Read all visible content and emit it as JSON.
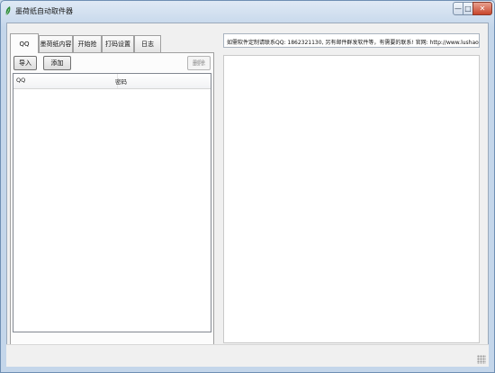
{
  "window": {
    "title": "墨荷纸自动取件器",
    "controls": {
      "minimize": "—",
      "maximize": "□",
      "close": "✕"
    }
  },
  "tabs": [
    {
      "label": "QQ",
      "active": true
    },
    {
      "label": "墨荷纸内容",
      "active": false
    },
    {
      "label": "开始抢",
      "active": false
    },
    {
      "label": "打码设置",
      "active": false
    },
    {
      "label": "日志",
      "active": false
    }
  ],
  "toolbar": {
    "import_label": "导入",
    "add_label": "添加",
    "delete_label": "删除"
  },
  "account_list": {
    "columns": [
      "QQ",
      "密码"
    ],
    "rows": []
  },
  "info_bar": {
    "value": "如需软件定制请联系QQ: 1862321130, 另有邮件群发软件等，有需要的联系! 官网: http://www.lushaolin.com"
  },
  "colors": {
    "titlebar": "#c4d6ea",
    "client_bg": "#f0f0f0",
    "close_button": "#c8452b",
    "app_icon": "#2e8b3a"
  },
  "icons": {
    "app": "leaf-icon",
    "minimize": "minimize-icon",
    "maximize": "maximize-icon",
    "close": "close-icon",
    "grip": "resize-grip-icon"
  }
}
